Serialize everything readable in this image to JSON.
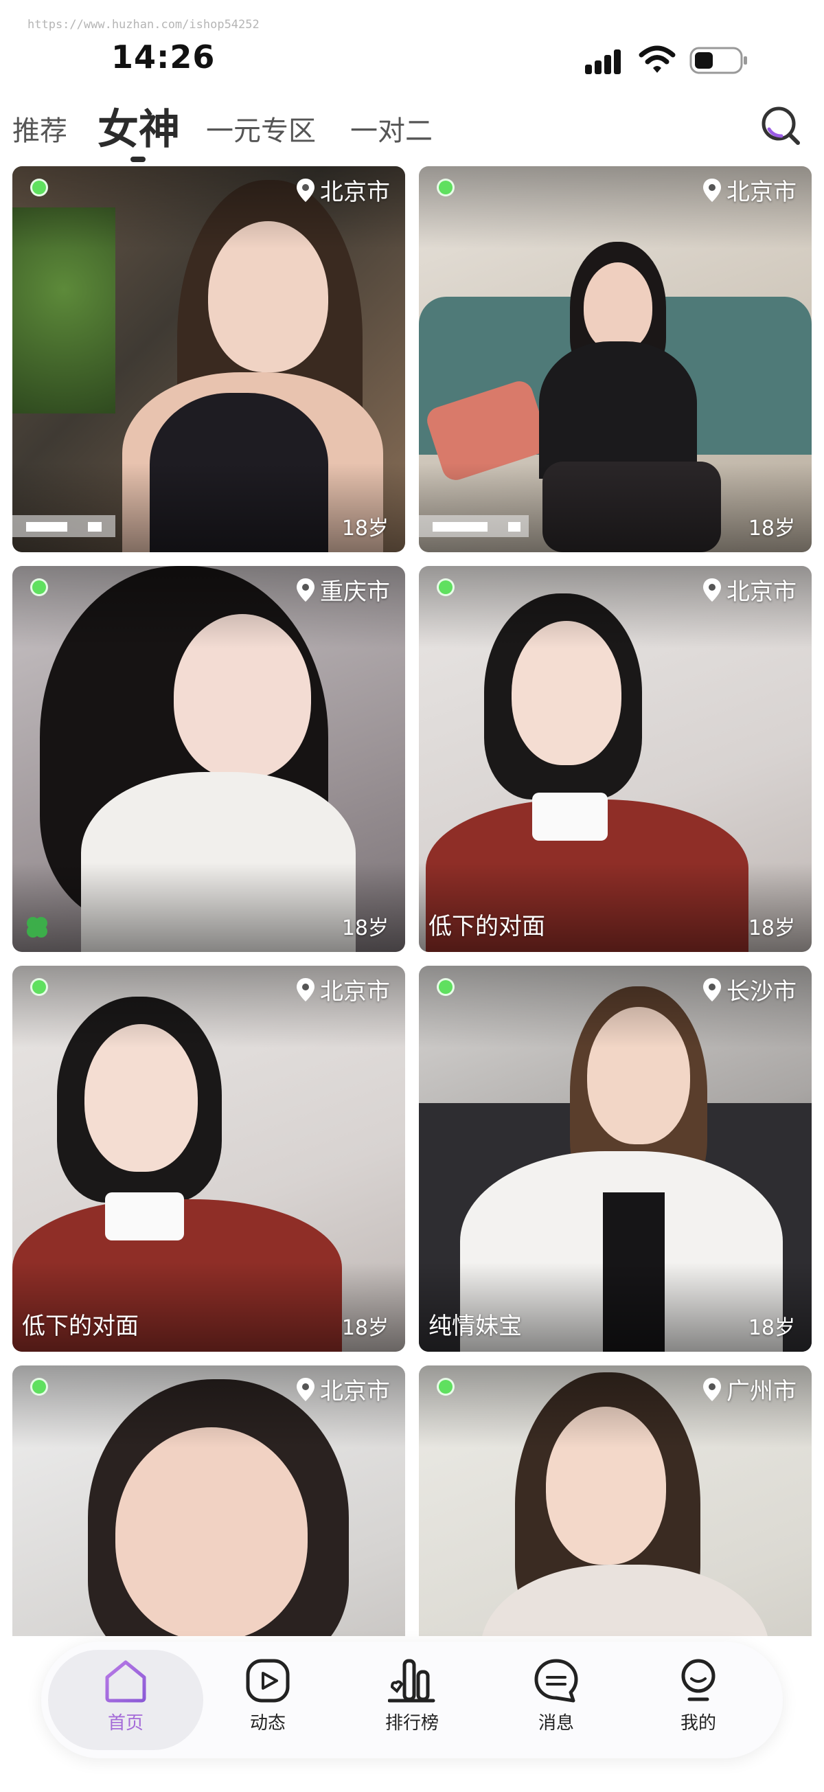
{
  "watermark": "https://www.huzhan.com/ishop54252",
  "status": {
    "time": "14:26"
  },
  "tabs": [
    {
      "label": "推荐",
      "active": false
    },
    {
      "label": "女神",
      "active": true
    },
    {
      "label": "一元专区",
      "active": false
    },
    {
      "label": "一对二",
      "active": false
    }
  ],
  "cards": [
    {
      "location": "北京市",
      "age": "18岁",
      "nickname": "",
      "online": true
    },
    {
      "location": "北京市",
      "age": "18岁",
      "nickname": "",
      "online": true
    },
    {
      "location": "重庆市",
      "age": "18岁",
      "nickname": "",
      "online": true
    },
    {
      "location": "北京市",
      "age": "18岁",
      "nickname": "低下的对面",
      "online": true
    },
    {
      "location": "北京市",
      "age": "18岁",
      "nickname": "低下的对面",
      "online": true
    },
    {
      "location": "长沙市",
      "age": "18岁",
      "nickname": "纯情妹宝",
      "online": true
    },
    {
      "location": "北京市",
      "age": "",
      "nickname": "",
      "online": true
    },
    {
      "location": "广州市",
      "age": "",
      "nickname": "",
      "online": true
    }
  ],
  "bottom_nav": [
    {
      "label": "首页",
      "icon": "home-icon",
      "active": true
    },
    {
      "label": "动态",
      "icon": "play-icon",
      "active": false
    },
    {
      "label": "排行榜",
      "icon": "ranking-icon",
      "active": false
    },
    {
      "label": "消息",
      "icon": "message-icon",
      "active": false
    },
    {
      "label": "我的",
      "icon": "profile-icon",
      "active": false
    }
  ],
  "colors": {
    "accent": "#a46ad8",
    "online": "#5fe05f"
  }
}
